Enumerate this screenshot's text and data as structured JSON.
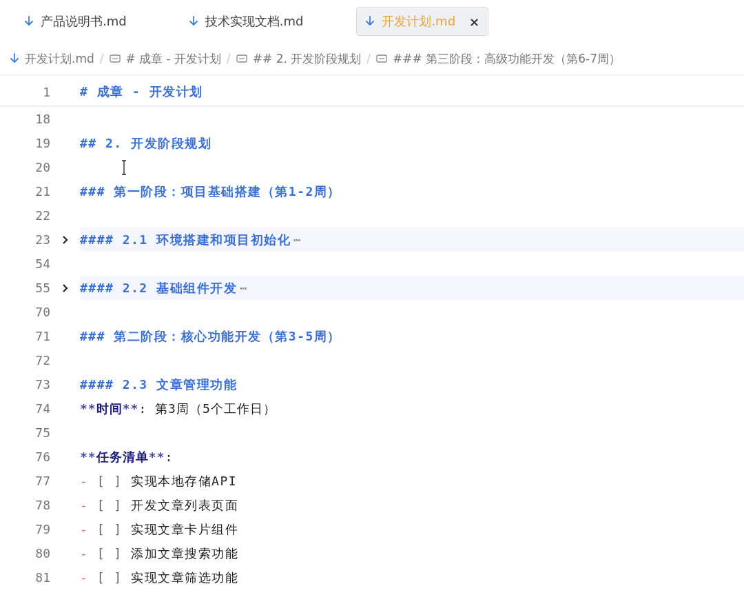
{
  "tabs": [
    {
      "label": "产品说明书.md",
      "selected": false
    },
    {
      "label": "技术实现文档.md",
      "selected": false
    },
    {
      "label": "开发计划.md",
      "selected": true,
      "close": "×"
    }
  ],
  "breadcrumb": [
    {
      "kind": "file",
      "label": "开发计划.md"
    },
    {
      "kind": "heading",
      "sep": "/",
      "label": "# 成章 - 开发计划"
    },
    {
      "kind": "heading",
      "sep": "/",
      "label": "## 2. 开发阶段规划"
    },
    {
      "kind": "heading",
      "sep": "/",
      "label": "### 第三阶段：高级功能开发（第6-7周）"
    }
  ],
  "sticky_line": {
    "number": "1",
    "kind": "heading",
    "text": "# 成章 - 开发计划"
  },
  "lines": [
    {
      "number": "18",
      "kind": "blank"
    },
    {
      "number": "19",
      "kind": "heading",
      "text": "## 2. 开发阶段规划"
    },
    {
      "number": "20",
      "kind": "blank",
      "cursor": true
    },
    {
      "number": "21",
      "kind": "heading",
      "text": "### 第一阶段：项目基础搭建（第1-2周）"
    },
    {
      "number": "22",
      "kind": "blank"
    },
    {
      "number": "23",
      "kind": "heading",
      "text": "#### 2.1 环境搭建和项目初始化",
      "folded": true,
      "ellipsis": "⋯"
    },
    {
      "number": "54",
      "kind": "blank"
    },
    {
      "number": "55",
      "kind": "heading",
      "text": "#### 2.2 基础组件开发",
      "folded": true,
      "ellipsis": "⋯"
    },
    {
      "number": "70",
      "kind": "blank"
    },
    {
      "number": "71",
      "kind": "heading",
      "text": "### 第二阶段：核心功能开发（第3-5周）"
    },
    {
      "number": "72",
      "kind": "blank"
    },
    {
      "number": "73",
      "kind": "heading",
      "text": "#### 2.3 文章管理功能"
    },
    {
      "number": "74",
      "kind": "field",
      "open": "**",
      "label": "时间",
      "close": "**",
      "rest": ": 第3周（5个工作日）"
    },
    {
      "number": "75",
      "kind": "blank"
    },
    {
      "number": "76",
      "kind": "field",
      "open": "**",
      "label": "任务清单",
      "close": "**",
      "rest": ":"
    },
    {
      "number": "77",
      "kind": "task",
      "bullet": "-",
      "box": "[ ]",
      "text": "实现本地存储API"
    },
    {
      "number": "78",
      "kind": "task",
      "bullet": "-",
      "box": "[ ]",
      "text": "开发文章列表页面"
    },
    {
      "number": "79",
      "kind": "task",
      "bullet": "-",
      "box": "[ ]",
      "text": "实现文章卡片组件"
    },
    {
      "number": "80",
      "kind": "task",
      "bullet": "-",
      "box": "[ ]",
      "text": "添加文章搜索功能"
    },
    {
      "number": "81",
      "kind": "task",
      "bullet": "-",
      "box": "[ ]",
      "text": "实现文章筛选功能"
    }
  ]
}
